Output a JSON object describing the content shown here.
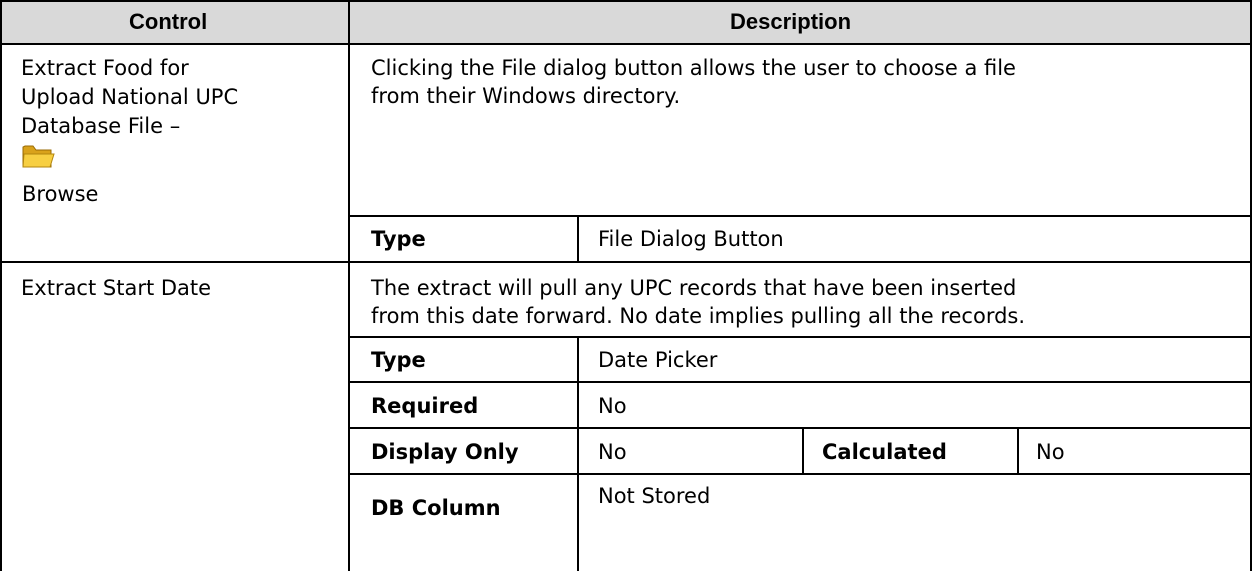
{
  "header": {
    "control": "Control",
    "description": "Description"
  },
  "rows": [
    {
      "control_lines": [
        "Extract Food for",
        "Upload National UPC",
        "Database File –"
      ],
      "control_button": "Browse",
      "control_icon": "folder-icon",
      "description_lines": [
        "Clicking the File dialog button allows the user to choose a file",
        "from their Windows directory."
      ],
      "type_label": "Type",
      "type_value": "File Dialog Button"
    },
    {
      "control": "Extract Start Date",
      "description_lines": [
        "The extract will pull any UPC records that have been inserted",
        "from this date forward.  No date implies pulling all the records."
      ],
      "type_label": "Type",
      "type_value": "Date Picker",
      "required_label": "Required",
      "required_value": "No",
      "display_only_label": "Display Only",
      "display_only_value": "No",
      "calculated_label": "Calculated",
      "calculated_value": "No",
      "db_column_label": "DB Column",
      "db_column_value": "Not Stored"
    }
  ]
}
